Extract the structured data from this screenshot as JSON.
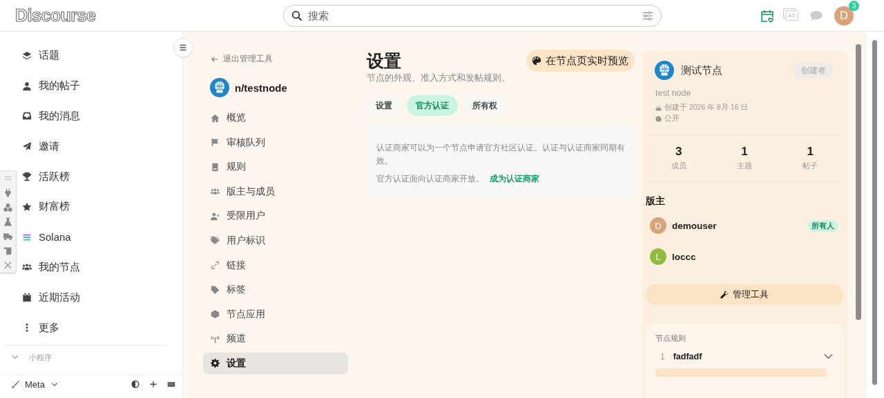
{
  "header": {
    "logo": "Discourse",
    "search": {
      "placeholder": "搜索"
    },
    "ad_label": "AD",
    "avatar_letter": "D",
    "notification_count": "3"
  },
  "sidebar": {
    "items": [
      {
        "label": "话题"
      },
      {
        "label": "我的帖子"
      },
      {
        "label": "我的消息"
      },
      {
        "label": "邀请"
      },
      {
        "label": "活跃榜"
      },
      {
        "label": "财富榜"
      },
      {
        "label": "Solana"
      },
      {
        "label": "我的节点"
      },
      {
        "label": "近期活动"
      },
      {
        "label": "更多"
      }
    ],
    "section": "小程序",
    "footer": "Meta"
  },
  "admin_nav": {
    "back": "退出管理工具",
    "node_name": "n/testnode",
    "items": [
      {
        "label": "概览",
        "selected": false
      },
      {
        "label": "审核队列",
        "selected": false
      },
      {
        "label": "规则",
        "selected": false
      },
      {
        "label": "版主与成员",
        "selected": false
      },
      {
        "label": "受限用户",
        "selected": false
      },
      {
        "label": "用户标识",
        "selected": false
      },
      {
        "label": "链接",
        "selected": false
      },
      {
        "label": "标签",
        "selected": false
      },
      {
        "label": "节点应用",
        "selected": false
      },
      {
        "label": "频道",
        "selected": false
      },
      {
        "label": "设置",
        "selected": true
      }
    ]
  },
  "settings": {
    "title": "设置",
    "subtitle": "节点的外观、准入方式和发帖规则。",
    "preview_button": "在节点页实时预览",
    "tabs": [
      {
        "label": "设置",
        "selected": false
      },
      {
        "label": "官方认证",
        "selected": true
      },
      {
        "label": "所有权",
        "selected": false
      }
    ],
    "info": {
      "text": "认证商家可以为一个节点申请官方社区认证。认证与认证商家同期有效。",
      "note": "官方认证面向认证商家开放。",
      "link": "成为认证商家"
    }
  },
  "node_card": {
    "name": "测试节点",
    "role_badge": "创建者",
    "description": "test node",
    "created": "创建于 2026 年 8月 16 日",
    "visibility": "公开",
    "stats": [
      {
        "value": "3",
        "label": "成员"
      },
      {
        "value": "1",
        "label": "主题"
      },
      {
        "value": "1",
        "label": "帖子"
      }
    ],
    "moderators_title": "版主",
    "moderators": [
      {
        "letter": "D",
        "name": "demouser",
        "color": "#d9a47c",
        "badge": "所有人"
      },
      {
        "letter": "L",
        "name": "loccc",
        "color": "#8fbc3f"
      }
    ],
    "admin_button": "管理工具",
    "rules": {
      "title": "节点规则",
      "items": [
        {
          "number": "1",
          "text": "fadfadf",
          "expanded": false
        }
      ]
    }
  }
}
